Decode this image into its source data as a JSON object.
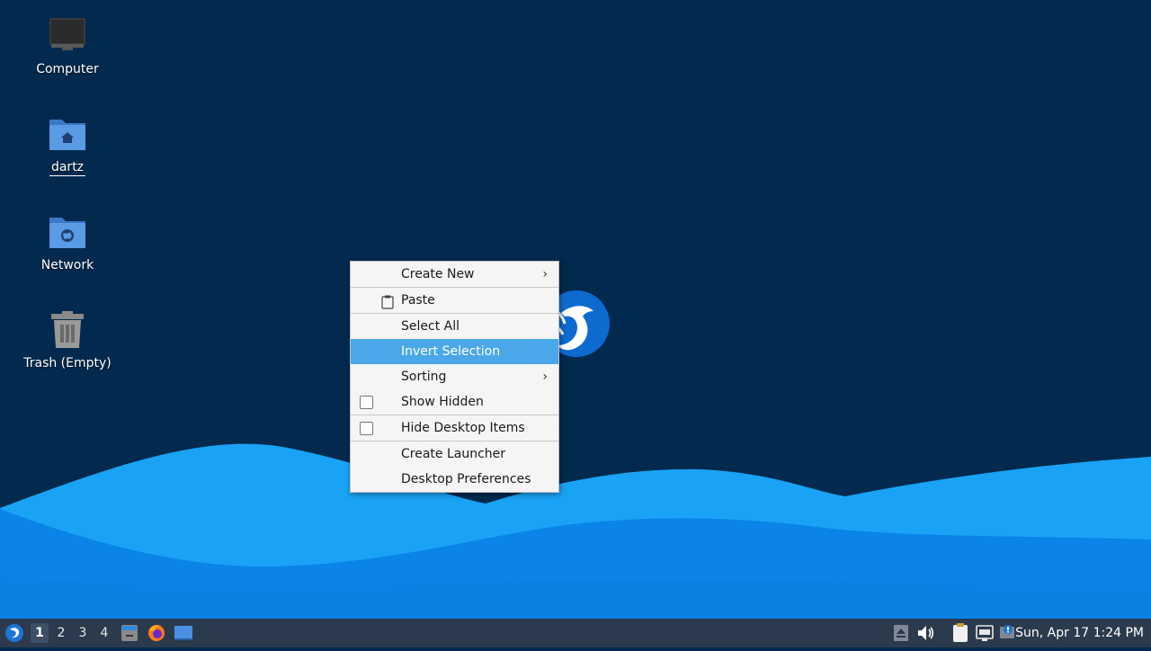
{
  "desktop": {
    "icons": [
      {
        "label": "Computer"
      },
      {
        "label": "dartz"
      },
      {
        "label": "Network"
      },
      {
        "label": "Trash (Empty)"
      }
    ]
  },
  "context_menu": {
    "items": [
      {
        "label": "Create New",
        "submenu": true
      },
      {
        "label": "Paste",
        "icon": "clipboard-icon"
      },
      {
        "label": "Select All"
      },
      {
        "label": "Invert Selection",
        "highlighted": true
      },
      {
        "label": "Sorting",
        "submenu": true
      },
      {
        "label": "Show Hidden",
        "checked": false
      },
      {
        "label": "Hide Desktop Items",
        "checked": false
      },
      {
        "label": "Create Launcher"
      },
      {
        "label": "Desktop Preferences"
      }
    ],
    "highlight_color": "#4aa8e8"
  },
  "taskbar": {
    "workspaces": [
      "1",
      "2",
      "3",
      "4"
    ],
    "active_workspace": "1",
    "clock": "Sun, Apr 17  1:24 PM",
    "background": "#2b3a4d"
  },
  "colors": {
    "desktop_bg": "#012a4e",
    "wave_light": "#1aa3f5",
    "wave_dark": "#0a7fe0"
  }
}
